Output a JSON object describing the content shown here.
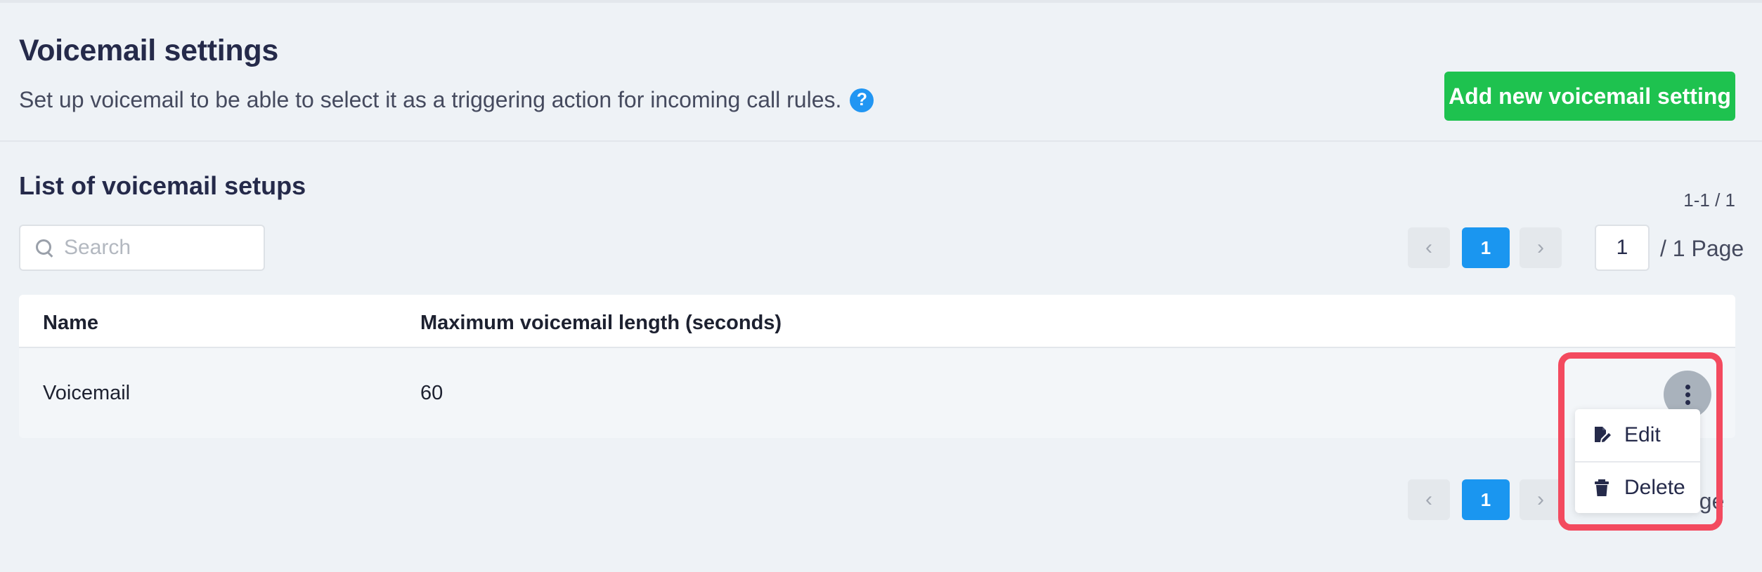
{
  "header": {
    "title": "Voicemail settings",
    "description": "Set up voicemail to be able to select it as a triggering action for incoming call rules.",
    "help_glyph": "?",
    "add_button_label": "Add new voicemail setting"
  },
  "list": {
    "title": "List of voicemail setups",
    "range_count": "1-1 / 1",
    "search_placeholder": "Search"
  },
  "pager": {
    "prev_glyph": "‹",
    "next_glyph": "›",
    "current_page": "1",
    "page_input_value": "1",
    "total_pages_text": "/ 1 Page",
    "bottom_partial_text": "age"
  },
  "table": {
    "columns": [
      "Name",
      "Maximum voicemail length (seconds)"
    ],
    "rows": [
      {
        "name": "Voicemail",
        "max_length": "60"
      }
    ]
  },
  "row_menu": {
    "items": [
      {
        "label": "Edit",
        "icon": "edit-document-icon"
      },
      {
        "label": "Delete",
        "icon": "trash-icon"
      }
    ]
  },
  "colors": {
    "accent_blue": "#1a96f0",
    "add_green": "#1ec24f",
    "highlight_red": "#f34a5f"
  }
}
